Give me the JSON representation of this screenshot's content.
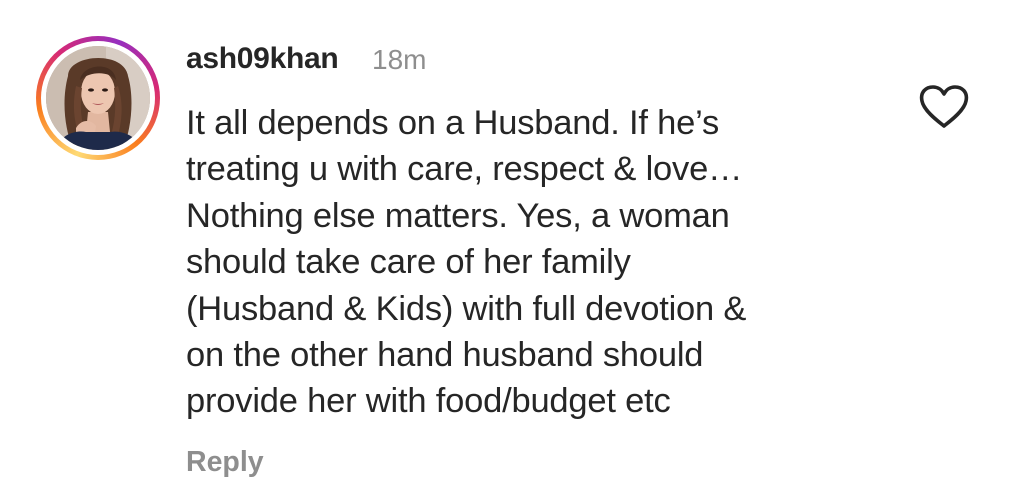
{
  "comment": {
    "username": "ash09khan",
    "timestamp": "18m",
    "text_lines": [
      "It all depends on a Husband. If he’s",
      "treating u with care, respect & love…",
      "Nothing else matters. Yes, a woman",
      "should take care of her family",
      "(Husband & Kids) with full devotion &",
      "on the other hand husband should",
      "provide her with food/budget etc"
    ],
    "reply_label": "Reply",
    "like_icon": "heart-outline-icon",
    "avatar_ring": "story-ring-gradient"
  },
  "colors": {
    "text": "#262626",
    "secondary": "#8e8e8e",
    "background": "#ffffff"
  }
}
